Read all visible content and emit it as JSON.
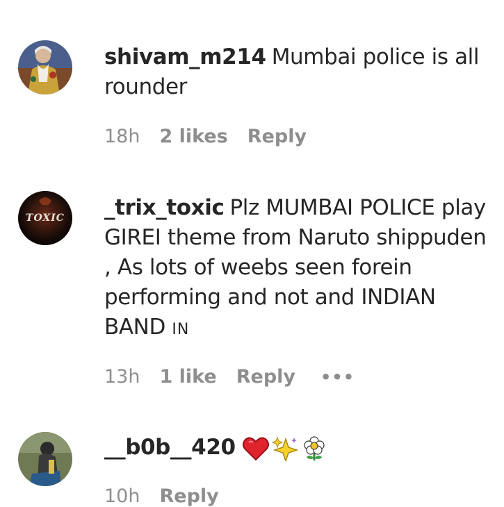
{
  "comments": [
    {
      "username": "shivam_m214",
      "text": "Mumbai police is all rounder",
      "time": "18h",
      "likes": "2 likes",
      "reply": "Reply"
    },
    {
      "username": "_trix_toxic",
      "text": "Plz MUMBAI POLICE play GIREI theme from Naruto shippuden , As lots of weebs seen forein performing and not and INDIAN BAND",
      "flag_text": "IN",
      "time": "13h",
      "likes": "1 like",
      "reply": "Reply",
      "more": "•••"
    },
    {
      "username": "__b0b__420",
      "text": "",
      "emojis": [
        "red-heart-icon",
        "sparkles-icon",
        "flower-icon"
      ],
      "time": "10h",
      "reply": "Reply"
    }
  ],
  "avatar_text": {
    "trix": "TOXIC"
  },
  "colors": {
    "text": "#262626",
    "meta": "#8e8e8e",
    "background": "#ffffff"
  }
}
